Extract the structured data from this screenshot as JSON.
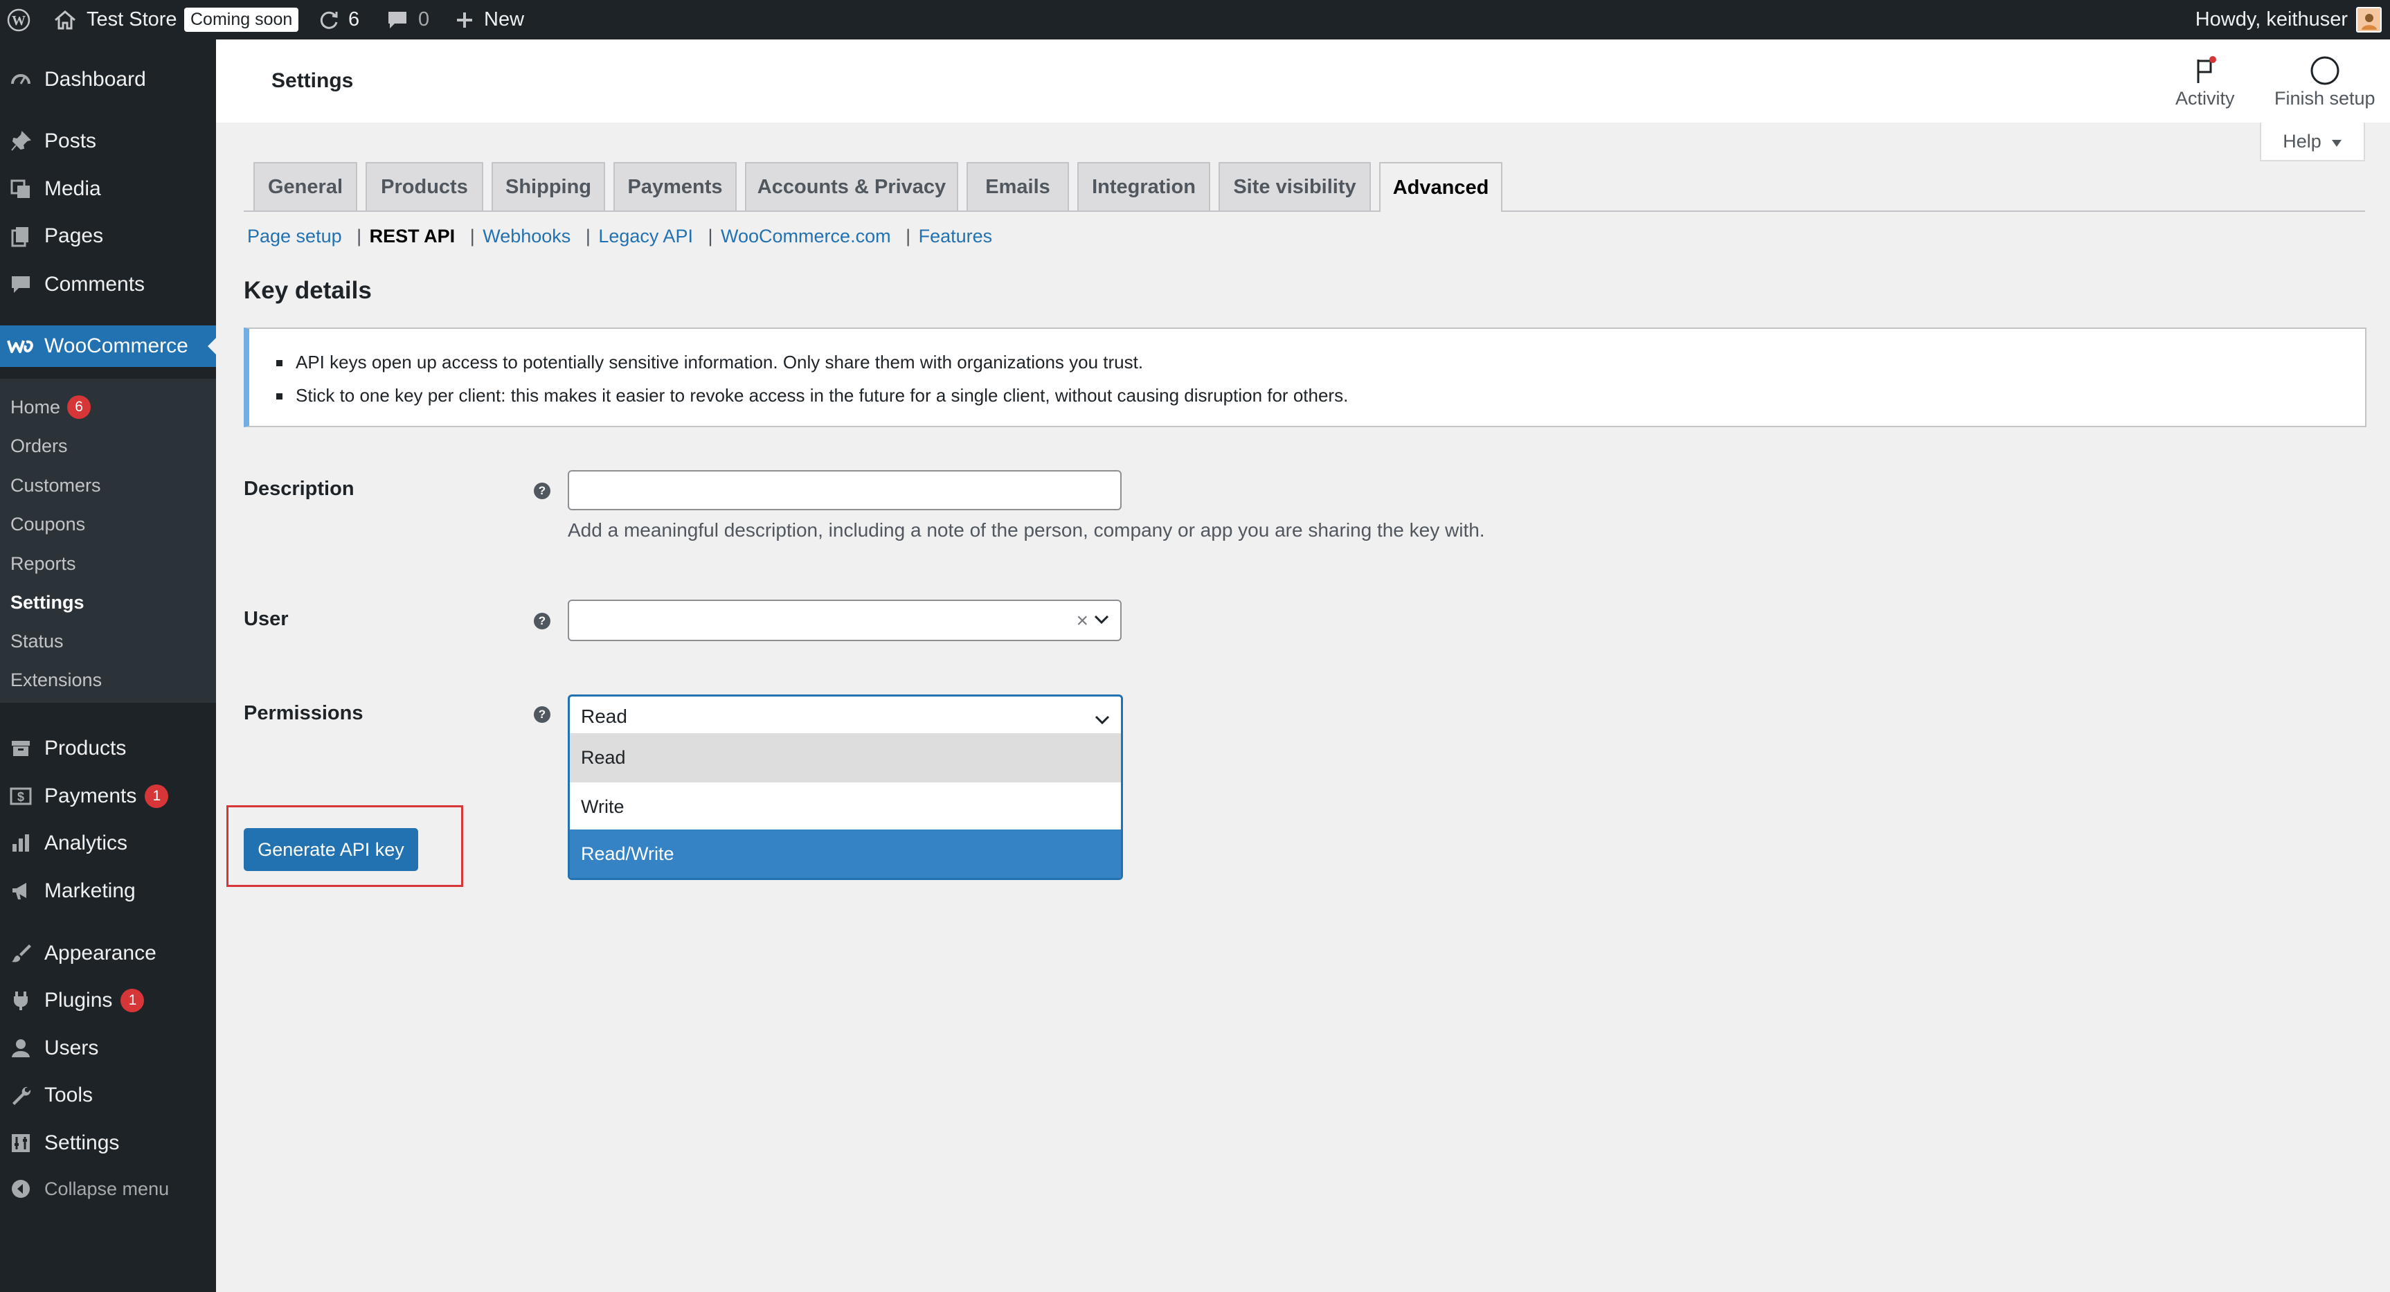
{
  "colors": {
    "admin_bar_bg": "#1d2327",
    "sidebar_bg": "#1d2327",
    "submenu_bg": "#2c3338",
    "accent": "#2271b1",
    "selected_option": "#3582c4",
    "badge": "#d63638",
    "highlight": "#d63638",
    "page_bg": "#f0f0f1"
  },
  "admin_bar": {
    "wp_logo_icon": "wordpress-logo-icon",
    "site_name": "Test Store",
    "coming_soon": "Coming soon",
    "updates_count": "6",
    "comments_count": "0",
    "new_label": "New",
    "greeting": "Howdy, keithuser"
  },
  "sidebar": {
    "items": [
      {
        "label": "Dashboard",
        "icon": "dashboard-icon"
      },
      {
        "label": "Posts",
        "icon": "pin-icon"
      },
      {
        "label": "Media",
        "icon": "media-icon"
      },
      {
        "label": "Pages",
        "icon": "pages-icon"
      },
      {
        "label": "Comments",
        "icon": "comment-icon"
      },
      {
        "label": "WooCommerce",
        "icon": "woo-icon"
      },
      {
        "label": "Products",
        "icon": "archive-icon"
      },
      {
        "label": "Payments",
        "icon": "payments-icon",
        "badge": "1"
      },
      {
        "label": "Analytics",
        "icon": "chart-icon"
      },
      {
        "label": "Marketing",
        "icon": "megaphone-icon"
      },
      {
        "label": "Appearance",
        "icon": "brush-icon"
      },
      {
        "label": "Plugins",
        "icon": "plugin-icon",
        "badge": "1"
      },
      {
        "label": "Users",
        "icon": "user-icon"
      },
      {
        "label": "Tools",
        "icon": "wrench-icon"
      },
      {
        "label": "Settings",
        "icon": "settings-icon"
      },
      {
        "label": "Collapse menu",
        "icon": "collapse-icon"
      }
    ],
    "woo_submenu": [
      {
        "label": "Home",
        "badge": "6"
      },
      {
        "label": "Orders"
      },
      {
        "label": "Customers"
      },
      {
        "label": "Coupons"
      },
      {
        "label": "Reports"
      },
      {
        "label": "Settings"
      },
      {
        "label": "Status"
      },
      {
        "label": "Extensions"
      }
    ]
  },
  "header": {
    "title": "Settings",
    "activity": "Activity",
    "finish_setup": "Finish setup"
  },
  "help": "Help",
  "tabs": [
    "General",
    "Products",
    "Shipping",
    "Payments",
    "Accounts & Privacy",
    "Emails",
    "Integration",
    "Site visibility",
    "Advanced"
  ],
  "subnav": [
    "Page setup",
    "REST API",
    "Webhooks",
    "Legacy API",
    "WooCommerce.com",
    "Features"
  ],
  "separator": "|",
  "section_title": "Key details",
  "notice": [
    "API keys open up access to potentially sensitive information. Only share them with organizations you trust.",
    "Stick to one key per client: this makes it easier to revoke access in the future for a single client, without causing disruption for others."
  ],
  "form": {
    "description_label": "Description",
    "description_value": "",
    "description_hint": "Add a meaningful description, including a note of the person, company or app you are sharing the key with.",
    "user_label": "User",
    "user_clear": "×",
    "permissions_label": "Permissions",
    "permissions_value": "Read",
    "permission_options": [
      "Read",
      "Write",
      "Read/Write"
    ],
    "help_tip": "?"
  },
  "generate_button": "Generate API key"
}
